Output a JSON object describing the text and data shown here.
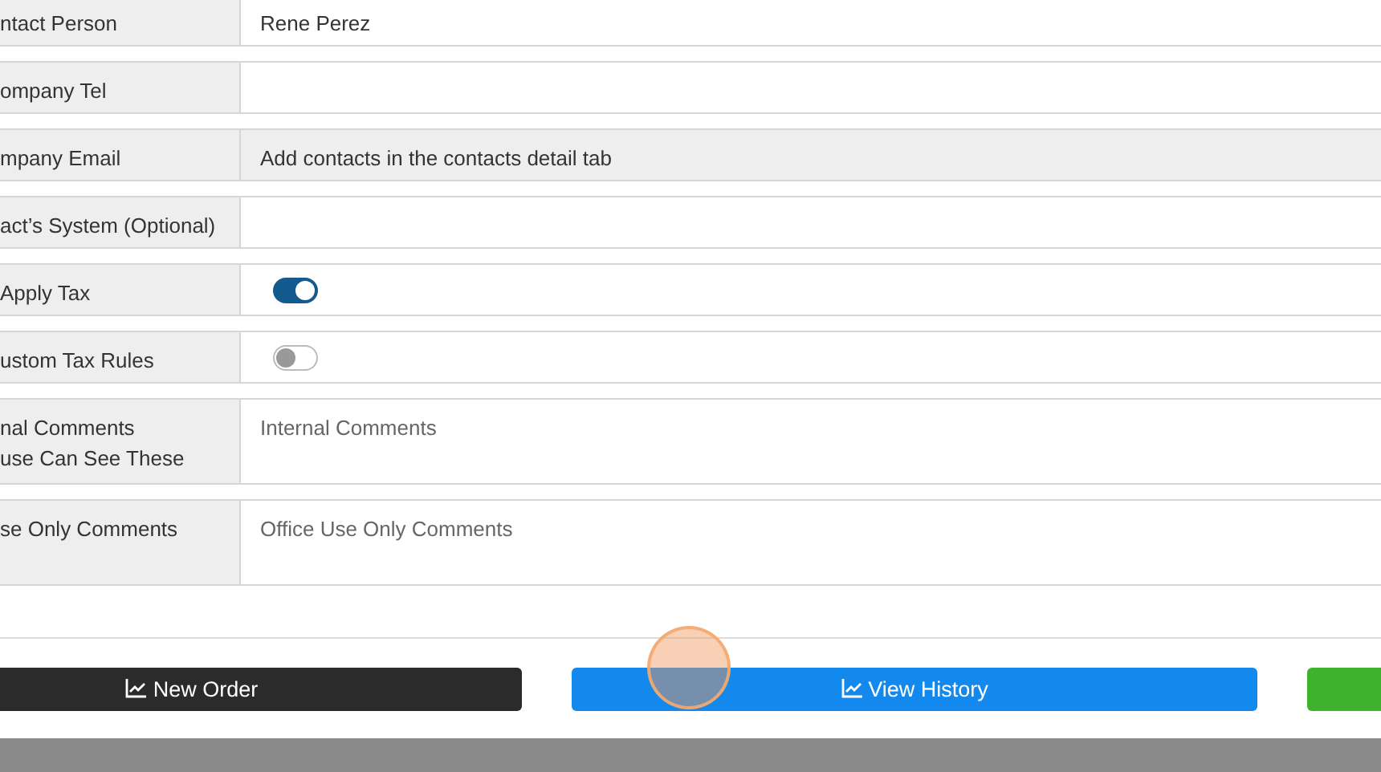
{
  "fields": [
    {
      "label": "ntact Person",
      "kind": "text",
      "value": "Rene Perez",
      "readonly": false
    },
    {
      "label": "ompany Tel",
      "kind": "text",
      "readonly": false
    },
    {
      "label": "mpany Email",
      "kind": "text",
      "value": "Add contacts in the contacts detail tab",
      "readonly": true
    },
    {
      "label": "act’s System (Optional)",
      "kind": "text",
      "readonly": false
    },
    {
      "label": "Apply Tax",
      "kind": "toggle",
      "on": true
    },
    {
      "label": "ustom Tax Rules",
      "kind": "toggle",
      "on": false
    },
    {
      "label": "nal Comments\nuse Can See These",
      "kind": "textarea",
      "placeholder": "Internal Comments"
    },
    {
      "label": "se Only Comments",
      "kind": "textarea",
      "placeholder": "Office Use Only Comments"
    }
  ],
  "buttons": [
    {
      "label": "New Order",
      "kind": "dark"
    },
    {
      "label": "View History",
      "kind": "primary"
    },
    {
      "kind": "success"
    }
  ]
}
